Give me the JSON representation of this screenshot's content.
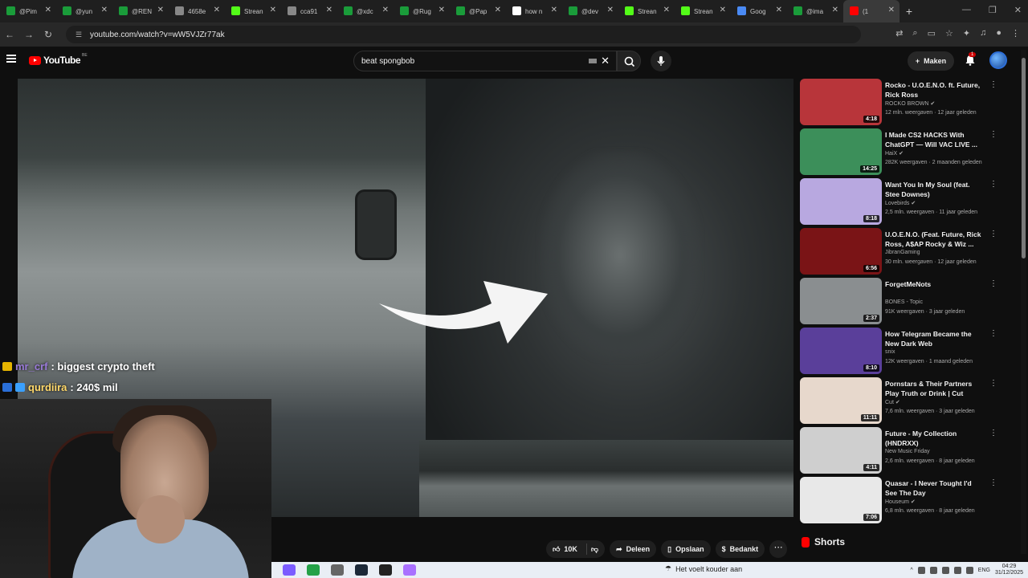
{
  "browser": {
    "tabs": [
      {
        "label": "@Pim",
        "color": "#1a9c3a"
      },
      {
        "label": "@yun",
        "color": "#1a9c3a"
      },
      {
        "label": "@REN",
        "color": "#1a9c3a"
      },
      {
        "label": "4658e",
        "color": "#888888"
      },
      {
        "label": "Strean",
        "color": "#53fc18"
      },
      {
        "label": "cca91",
        "color": "#888888"
      },
      {
        "label": "@xdc",
        "color": "#1a9c3a"
      },
      {
        "label": "@Rug",
        "color": "#1a9c3a"
      },
      {
        "label": "@Pap",
        "color": "#1a9c3a"
      },
      {
        "label": "how n",
        "color": "#ffffff"
      },
      {
        "label": "@dev",
        "color": "#1a9c3a"
      },
      {
        "label": "Strean",
        "color": "#53fc18"
      },
      {
        "label": "Strean",
        "color": "#53fc18"
      },
      {
        "label": "Goog",
        "color": "#4a8af4"
      },
      {
        "label": "@ima",
        "color": "#1a9c3a"
      },
      {
        "label": "(1",
        "color": "#ff0000"
      }
    ],
    "url": "youtube.com/watch?v=wW5VJZr77ak"
  },
  "youtube": {
    "logo_text": "YouTube",
    "country_code": "BE",
    "search_query": "beat spongbob",
    "create_label": "Maken",
    "notification_count": "1"
  },
  "overlay": {
    "chat": [
      {
        "user": "mr_crf",
        "message": ": biggest crypto theft"
      },
      {
        "user": "qurdiira",
        "message": ": 240$ mil"
      }
    ]
  },
  "actions": {
    "likes": "10K",
    "share": "Deleen",
    "save": "Opslaan",
    "thanks": "Bedankt"
  },
  "recommendations": [
    {
      "title": "Rocko - U.O.E.N.O. ft. Future, Rick Ross",
      "channel": "ROCKO BROWN",
      "meta": "12 mln. weergaven · 12 jaar geleden",
      "duration": "4:18",
      "thumb": "#b8353a",
      "verified": true
    },
    {
      "title": "I Made CS2 HACKS With ChatGPT — Will VAC LIVE ...",
      "channel": "HaiX",
      "meta": "282K weergaven · 2 maanden geleden",
      "duration": "14:25",
      "thumb": "#3c8f5a",
      "verified": true
    },
    {
      "title": "Want You In My Soul (feat. Stee Downes)",
      "channel": "Lovebirds",
      "meta": "2,5 mln. weergaven · 11 jaar geleden",
      "duration": "8:18",
      "thumb": "#b8a8e0",
      "verified": true
    },
    {
      "title": "U.O.E.N.O. (Feat. Future, Rick Ross, A$AP Rocky & Wiz ...",
      "channel": "JibranGaming",
      "meta": "30 mln. weergaven · 12 jaar geleden",
      "duration": "6:56",
      "thumb": "#7a1416",
      "verified": false
    },
    {
      "title": "ForgetMeNots",
      "channel": "BONES - Topic",
      "meta": "91K weergaven · 3 jaar geleden",
      "duration": "2:37",
      "thumb": "#8a8e90",
      "verified": false
    },
    {
      "title": "How Telegram Became the New Dark Web",
      "channel": "snix",
      "meta": "12K weergaven · 1 maand geleden",
      "duration": "8:10",
      "thumb": "#5a3f9a",
      "verified": false
    },
    {
      "title": "Pornstars & Their Partners Play Truth or Drink | Cut",
      "channel": "Cut",
      "meta": "7,6 mln. weergaven · 3 jaar geleden",
      "duration": "11:11",
      "thumb": "#e7d8cc",
      "verified": true
    },
    {
      "title": "Future - My Collection (HNDRXX)",
      "channel": "New Music Friday",
      "meta": "2,6 mln. weergaven · 8 jaar geleden",
      "duration": "4:11",
      "thumb": "#cfcfcf",
      "verified": false
    },
    {
      "title": "Quasar - I Never Tought I'd See The Day",
      "channel": "Houseum",
      "meta": "6,8 mln. weergaven · 8 jaar geleden",
      "duration": "7:06",
      "thumb": "#e8e8e8",
      "verified": true
    }
  ],
  "shorts_label": "Shorts",
  "taskbar": {
    "weather": "Het voelt kouder aan",
    "language": "ENG",
    "time": "04:29",
    "date": "31/12/2025"
  }
}
